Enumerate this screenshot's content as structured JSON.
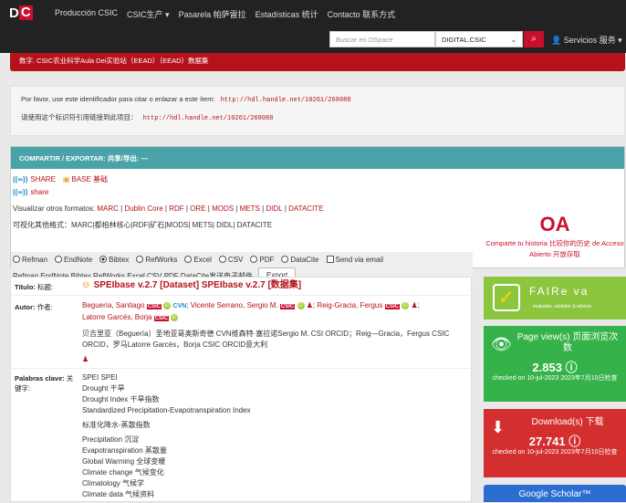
{
  "navbar": {
    "logo_d": "D",
    "logo_c": "C",
    "items": [
      "Producción CSIC",
      "CSIC生产 ▾",
      "Pasarela 帕萨雷拉",
      "Estadísticas 统计",
      "Contacto 联系方式"
    ],
    "search_placeholder": "Buscar en DSpace",
    "scope_selected": "DIGITAL.CSIC",
    "services": "Servicios 服务 ▾"
  },
  "banner": "数字. CSIC农业科学Aula Dei实验站（EEAD）（EEAD）数据集",
  "identifier": {
    "es_text": "Por favor, use este identificador para citar o enlazar a este ítem:",
    "zh_text": "请使用这个标识符引用链接到此项目：",
    "url": "http://hdl.handle.net/10261/268088"
  },
  "share": {
    "header": "COMPARTIR / EXPORTAR: 共享/导出: —",
    "share_label": "SHARE",
    "base_label": "BASE 基础",
    "share_lower": "share",
    "formats_label": "Visualizar otros formatos:",
    "formats": [
      "MARC",
      "Dublin Core",
      "RDF",
      "ORE",
      "MODS",
      "METS",
      "DIDL",
      "DATACITE"
    ],
    "formats_zh": "可视化其他格式：MARC|都柏林核心|RDF|矿石|MODS| METS| DIDL| DATACITE",
    "radio_options": [
      "Refman",
      "EndNote",
      "Bibtex",
      "RefWorks",
      "Excel",
      "CSV",
      "PDF",
      "DataCite"
    ],
    "radio_selected": "Bibtex",
    "send_email": "Send via email",
    "export_line_text": "Refman EndNote Bibtex RefWorks Excel CSV PDF DataCite发送电子邮件",
    "export_button": "Export",
    "oa_logo": "OA",
    "oa_text": "Comparte tu historia 比较你的历史 de Acceso Abierto 开放存取"
  },
  "metadata": {
    "title_label": "Título:",
    "title_label_zh": "标题:",
    "title": "SPEIbase v.2.7 [Dataset] SPEIbase v.2.7 [数据集]",
    "author_label": "Autor:",
    "author_label_zh": "作者:",
    "authors_line1a": "Beguería, Santiago",
    "authors_line1b": "Vicente Serrano, Sergio M.",
    "authors_line1c": "Reig-Gracia, Fergus",
    "authors_line2": "Latorre Garcés, Borja",
    "csic_tag": "CSIC",
    "orcid_tag": "iD",
    "cvn_tag": "CVN",
    "authors_zh": "贝吉里亚（Beguería）圣地亚哥奥斯奇德 CVN维森特·塞拉诺Sergio M. CSI ORCID；Reig—Gracia，Fergus CSIC ORCID，罗马Latorre Garcés，Borja CSIC ORCID意大利",
    "keywords_label": "Palabras clave:",
    "keywords_label_zh": "关键字:",
    "keywords_a": [
      "SPEI SPEI",
      "Drought 干旱",
      "Drought Index 干旱指数",
      "Standardized Precipitation-Evapotranspiration Index"
    ],
    "keywords_zh_line": "标准化降水-蒸散指数",
    "keywords_b": [
      "Precipitation 沉淀",
      "Evapotranspiration 蒸散量",
      "Global Warming 全球变暖",
      "Climate change 气候变化",
      "Climatology 气候学",
      "Climate data 气候资料"
    ]
  },
  "widgets": {
    "fair_title": "FAIRe va",
    "fair_sub": "evaluator, validator & advisor",
    "views_title": "Page view(s) 页面浏览次数",
    "views_count": "2.853",
    "views_date": "checked on 10-jul-2023  2023年7月10日检查",
    "downloads_title": "Download(s) 下载",
    "downloads_count": "27.741",
    "downloads_date": "checked on 10-jul-2023  2023年7月10日检查",
    "gscholar": "Google Scholar™"
  }
}
